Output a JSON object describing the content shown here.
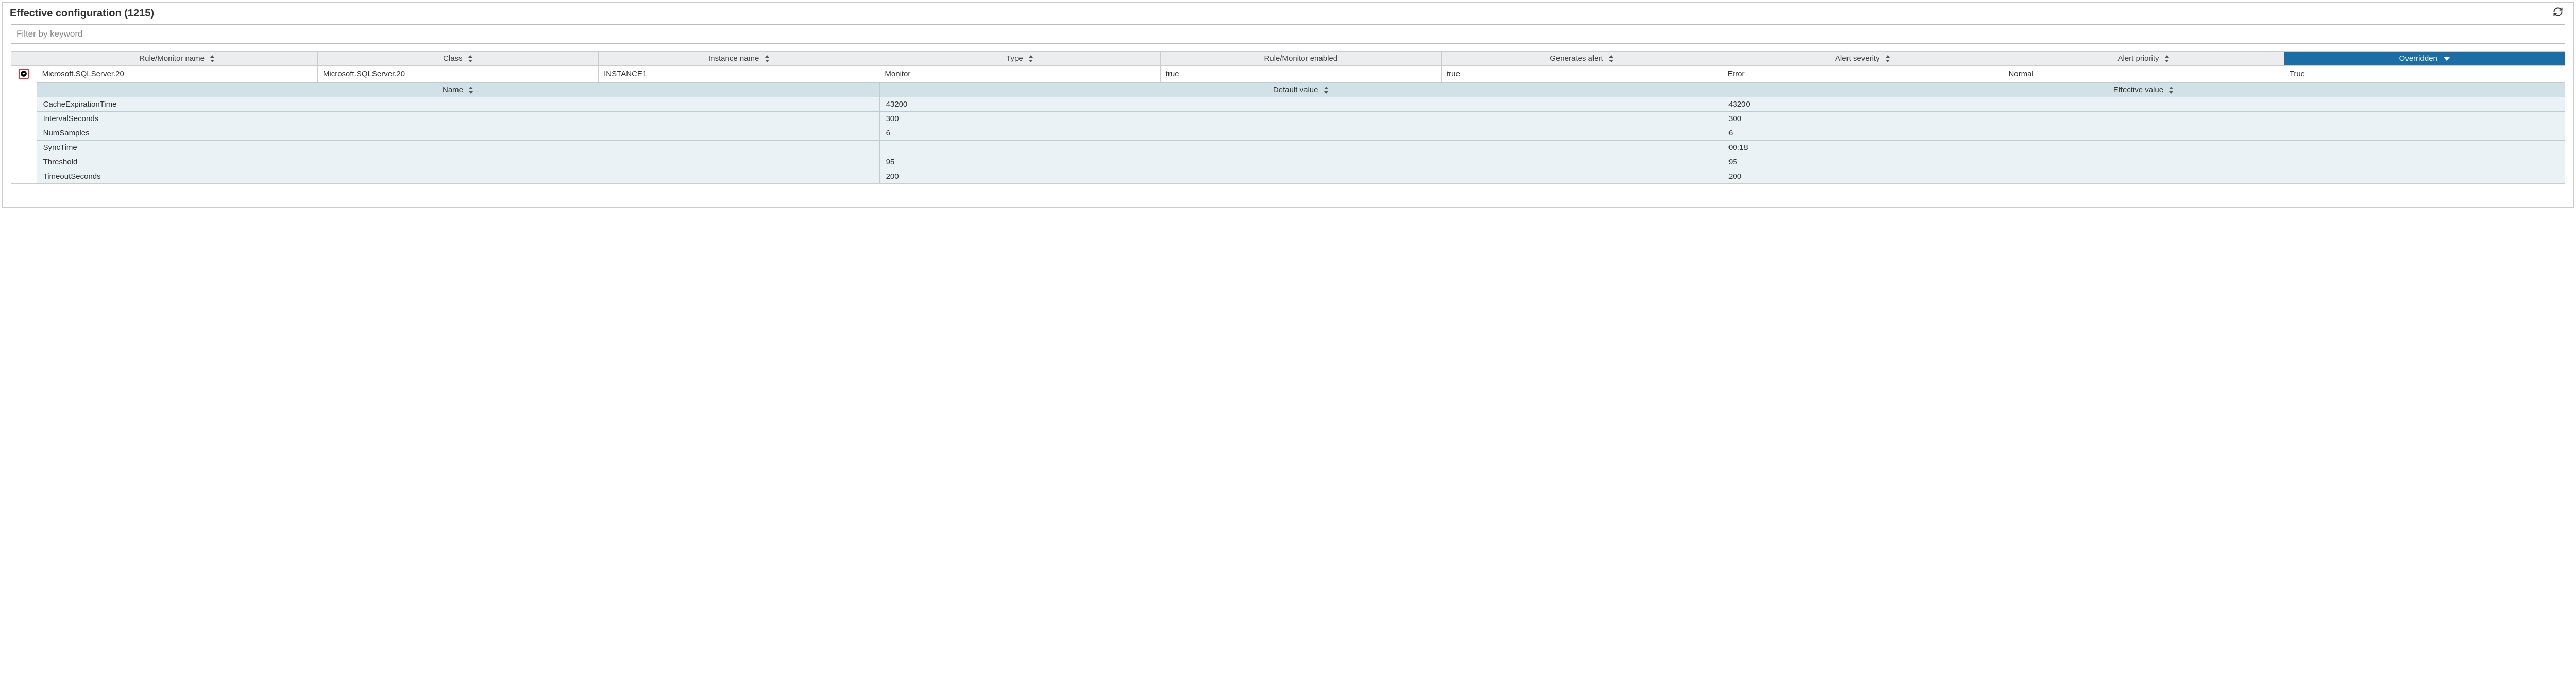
{
  "panel": {
    "title": "Effective configuration (1215)"
  },
  "filter": {
    "placeholder": "Filter by keyword",
    "value": ""
  },
  "columns": {
    "rule_monitor_name": "Rule/Monitor name",
    "class": "Class",
    "instance_name": "Instance name",
    "type": "Type",
    "rule_monitor_enabled": "Rule/Monitor enabled",
    "generates_alert": "Generates alert",
    "alert_severity": "Alert severity",
    "alert_priority": "Alert priority",
    "overridden": "Overridden"
  },
  "rows": [
    {
      "rule_monitor_name": "Microsoft.SQLServer.20",
      "class": "Microsoft.SQLServer.20",
      "instance_name": "INSTANCE1",
      "type": "Monitor",
      "rule_monitor_enabled": "true",
      "generates_alert": "true",
      "alert_severity": "Error",
      "alert_priority": "Normal",
      "overridden": "True"
    }
  ],
  "detail": {
    "columns": {
      "name": "Name",
      "default_value": "Default value",
      "effective_value": "Effective value"
    },
    "rows": [
      {
        "name": "CacheExpirationTime",
        "default_value": "43200",
        "effective_value": "43200"
      },
      {
        "name": "IntervalSeconds",
        "default_value": "300",
        "effective_value": "300"
      },
      {
        "name": "NumSamples",
        "default_value": "6",
        "effective_value": "6"
      },
      {
        "name": "SyncTime",
        "default_value": "",
        "effective_value": "00:18"
      },
      {
        "name": "Threshold",
        "default_value": "95",
        "effective_value": "95"
      },
      {
        "name": "TimeoutSeconds",
        "default_value": "200",
        "effective_value": "200"
      }
    ]
  }
}
